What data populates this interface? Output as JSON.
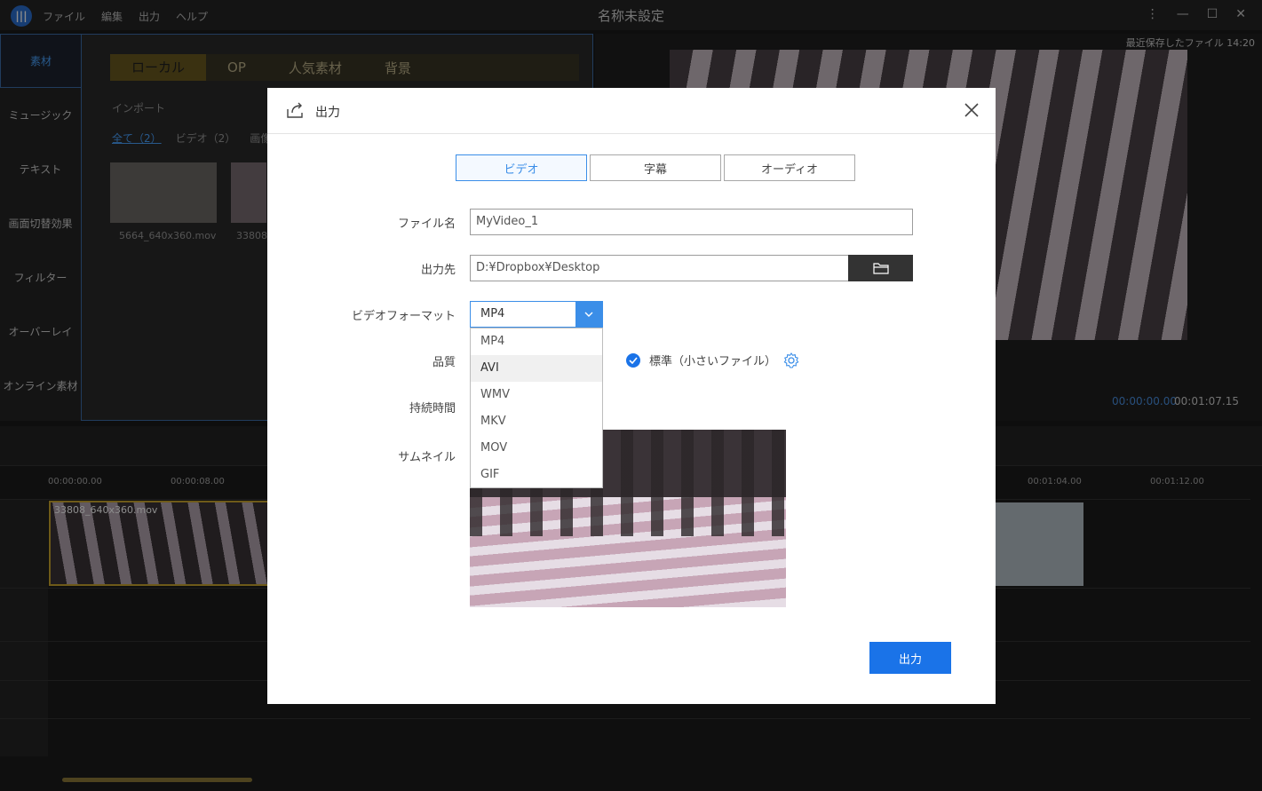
{
  "app": {
    "window_title": "名称未設定",
    "logo": "|||",
    "menu": [
      "ファイル",
      "編集",
      "出力",
      "ヘルプ"
    ]
  },
  "leftnav": {
    "items": [
      "素材",
      "ミュージック",
      "テキスト",
      "画面切替効果",
      "フィルター",
      "オーバーレイ",
      "オンライン素材"
    ]
  },
  "media": {
    "tabs": [
      "ローカル",
      "OP",
      "人気素材",
      "背景"
    ],
    "import_label": "インポート",
    "filters": [
      "全て（2）",
      "ビデオ（2）",
      "画像（"
    ],
    "files": [
      "5664_640x360.mov",
      "33808_"
    ]
  },
  "preview": {
    "saved_label": "最近保存したファイル 14:20",
    "time_current": "00:00:00.00",
    "time_separator": "/",
    "time_total": "00:01:07.15"
  },
  "timeline": {
    "ruler": [
      "00:00:00.00",
      "00:00:08.00",
      "00:01:04.00",
      "00:01:12.00"
    ],
    "clip_name": "33808_640x360.mov"
  },
  "dialog": {
    "title": "出力",
    "tabs": [
      "ビデオ",
      "字幕",
      "オーディオ"
    ],
    "active_tab": 0,
    "labels": {
      "filename": "ファイル名",
      "output_path": "出力先",
      "format": "ビデオフォーマット",
      "quality": "品質",
      "duration": "持続時間",
      "thumbnail": "サムネイル"
    },
    "filename_value": "MyVideo_1",
    "output_path_value": "D:¥Dropbox¥Desktop",
    "format_selected": "MP4",
    "format_options": [
      "MP4",
      "AVI",
      "WMV",
      "MKV",
      "MOV",
      "GIF"
    ],
    "format_hover": "AVI",
    "quality_option": "標準（小さいファイル）",
    "quality_checked": true,
    "export_button": "出力"
  },
  "colors": {
    "accent": "#1a73e8",
    "dialog_bg": "#ffffff",
    "app_bg": "#1b1b1b"
  },
  "icons": {
    "export": "export-icon",
    "close": "close-icon",
    "folder": "folder-icon",
    "dropdown": "chevron-down-icon",
    "check": "check-icon",
    "settings": "gear-icon"
  }
}
